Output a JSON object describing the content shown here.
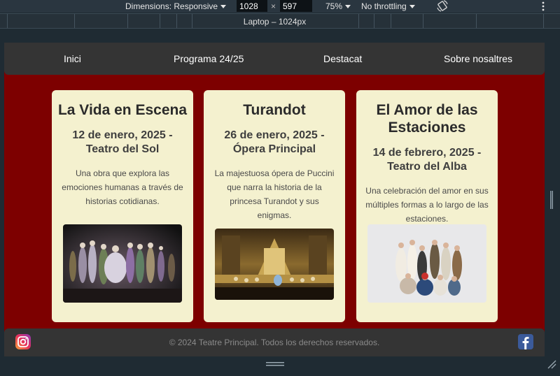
{
  "devtools": {
    "dimensions_label": "Dimensions: Responsive",
    "width_value": "1028",
    "times": "×",
    "height_value": "597",
    "zoom": "75%",
    "throttling": "No throttling",
    "device_label": "Laptop – 1024px"
  },
  "nav": {
    "items": [
      "Inici",
      "Programa 24/25",
      "Destacat",
      "Sobre nosaltres"
    ]
  },
  "cards": [
    {
      "title": "La Vida en Escena",
      "date_venue": "12 de enero, 2025 - Teatro del Sol",
      "description": "Una obra que explora las emociones humanas a través de historias cotidianas."
    },
    {
      "title": "Turandot",
      "date_venue": "26 de enero, 2025 - Ópera Principal",
      "description": "La majestuosa ópera de Puccini que narra la historia de la princesa Turandot y sus enigmas."
    },
    {
      "title": "El Amor de las Estaciones",
      "date_venue": "14 de febrero, 2025 - Teatro del Alba",
      "description": "Una celebración del amor en sus múltiples formas a lo largo de las estaciones."
    }
  ],
  "footer": {
    "copyright": "© 2024 Teatre Principal. Todos los derechos reservados."
  },
  "colors": {
    "page_background": "#7d0000",
    "nav_background": "#343434",
    "card_background": "#f4f1cf"
  },
  "icons": [
    "rotate-icon",
    "more-options-icon",
    "instagram-icon",
    "facebook-icon"
  ]
}
